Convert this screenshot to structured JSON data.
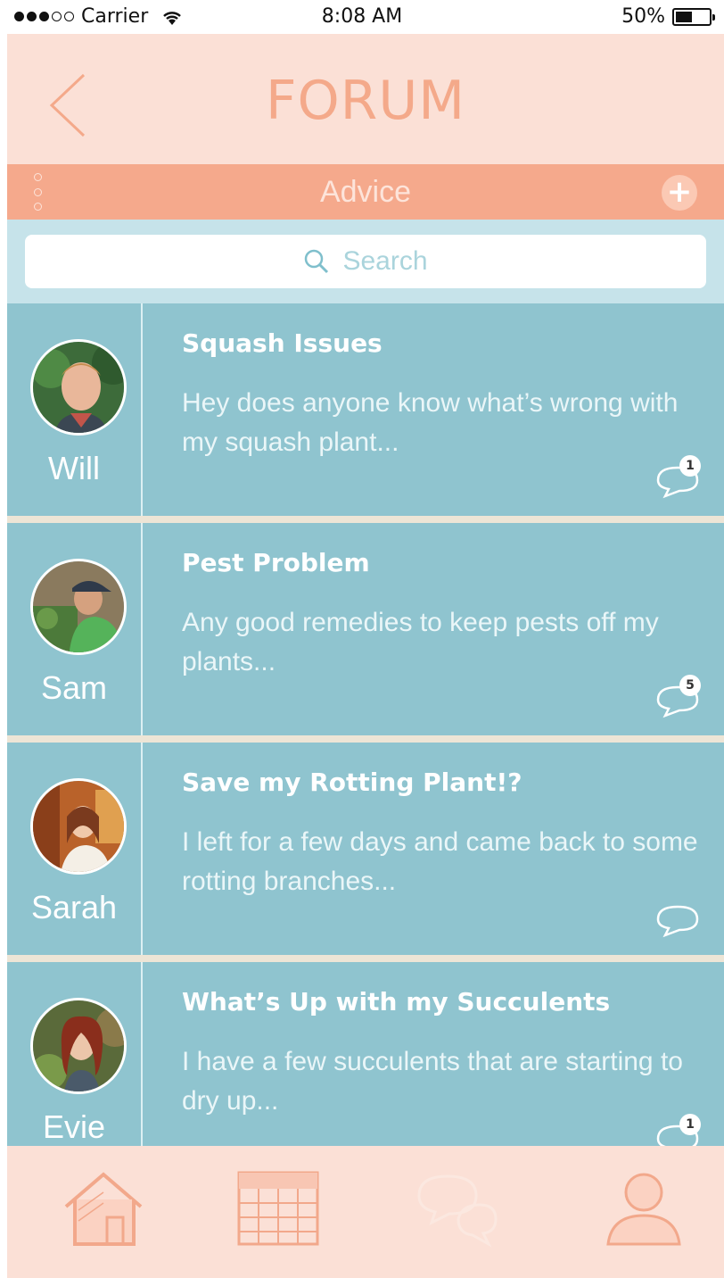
{
  "status_bar": {
    "carrier": "Carrier",
    "time": "8:08 AM",
    "battery_percent_label": "50%",
    "battery_level": 0.5,
    "signal_bars_filled": 3,
    "signal_bars_total": 5,
    "wifi_icon": "wifi-icon"
  },
  "header": {
    "title": "FORUM",
    "back_icon": "chevron-left-icon"
  },
  "category": {
    "title": "Advice",
    "menu_icon": "vertical-dots-icon",
    "add_icon": "plus-circle-icon"
  },
  "search": {
    "placeholder": "Search",
    "icon": "search-icon"
  },
  "posts": [
    {
      "user": "Will",
      "title": "Squash Issues",
      "preview": "Hey does anyone know what’s wrong with my squash plant...",
      "comments": "1"
    },
    {
      "user": "Sam",
      "title": "Pest Problem",
      "preview": "Any good remedies to keep pests off my plants...",
      "comments": "5"
    },
    {
      "user": "Sarah",
      "title": "Save my Rotting Plant!?",
      "preview": "I left for a few days and came back to some rotting branches...",
      "comments": ""
    },
    {
      "user": "Evie",
      "title": "What’s Up with my Succulents",
      "preview": "I have a few succulents that are starting to dry up...",
      "comments": "1"
    }
  ],
  "tab_bar": {
    "tabs": [
      {
        "icon": "home-icon",
        "active": false
      },
      {
        "icon": "calendar-icon",
        "active": false
      },
      {
        "icon": "chat-bubbles-icon",
        "active": true
      },
      {
        "icon": "profile-icon",
        "active": false
      }
    ]
  },
  "colors": {
    "header_bg": "#fbe0d6",
    "category_bg": "#f5a98c",
    "row_bg": "#8fc4cf",
    "accent_text": "#f4a98a"
  }
}
